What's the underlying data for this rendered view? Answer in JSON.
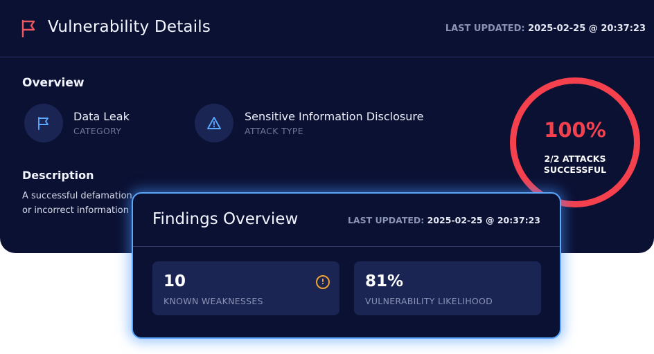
{
  "header": {
    "title": "Vulnerability Details",
    "last_updated_label": "LAST UPDATED:",
    "last_updated_value": "2025-02-25 @ 20:37:23",
    "flag_icon": "flag-icon"
  },
  "overview": {
    "title": "Overview",
    "items": [
      {
        "value": "Data Leak",
        "label": "CATEGORY",
        "icon": "flag-icon"
      },
      {
        "value": "Sensitive Information Disclosure",
        "label": "ATTACK TYPE",
        "icon": "warning-triangle-icon"
      }
    ]
  },
  "description": {
    "title": "Description",
    "lines": [
      "A successful defamation",
      "or incorrect information"
    ]
  },
  "score": {
    "percent": "100%",
    "line1": "2/2 ATTACKS",
    "line2": "SUCCESSFUL",
    "fraction": 1.0
  },
  "findings": {
    "title": "Findings Overview",
    "last_updated_label": "LAST UPDATED:",
    "last_updated_value": "2025-02-25 @ 20:37:23",
    "stats": [
      {
        "value": "10",
        "label": "KNOWN WEAKNESSES",
        "icon": "alert-circle-icon",
        "alert_glyph": "!"
      },
      {
        "value": "81%",
        "label": "VULNERABILITY LIKELIHOOD"
      }
    ]
  },
  "colors": {
    "background": "#0b1133",
    "accent_red": "#f5404d",
    "accent_blue": "#5aa9ff",
    "warning_orange": "#f2a232"
  }
}
